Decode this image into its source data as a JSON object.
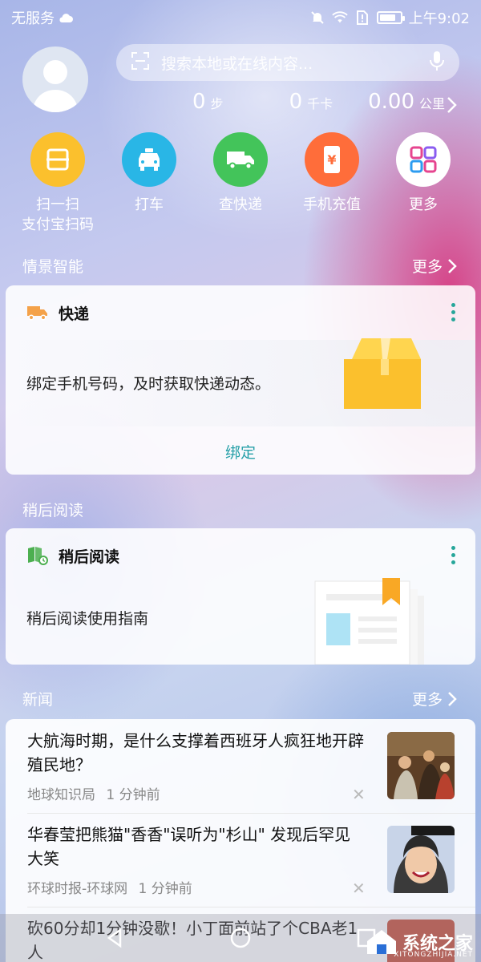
{
  "status_bar": {
    "carrier": "无服务",
    "time": "上午9:02"
  },
  "search": {
    "placeholder": "搜索本地或在线内容..."
  },
  "stats": [
    {
      "value": "0",
      "unit": "步"
    },
    {
      "value": "0",
      "unit": "千卡"
    },
    {
      "value": "0.00",
      "unit": "公里"
    }
  ],
  "quick_actions": [
    {
      "label": "扫一扫\n支付宝扫码",
      "color": "#fbc02d",
      "icon": "scan-icon"
    },
    {
      "label": "打车",
      "color": "#29b6e6",
      "icon": "taxi-icon"
    },
    {
      "label": "查快递",
      "color": "#43c45a",
      "icon": "delivery-truck-icon"
    },
    {
      "label": "手机充值",
      "color": "#ff6d3a",
      "icon": "phone-recharge-icon"
    },
    {
      "label": "更多",
      "color": "#ffffff",
      "icon": "more-grid-icon"
    }
  ],
  "sections": {
    "smart": {
      "title": "情景智能",
      "more": "更多"
    },
    "read_later": {
      "title": "稍后阅读"
    },
    "news": {
      "title": "新闻",
      "more": "更多"
    }
  },
  "express_card": {
    "title": "快递",
    "text": "绑定手机号码，及时获取快递动态。",
    "action": "绑定"
  },
  "read_card": {
    "title": "稍后阅读",
    "text": "稍后阅读使用指南"
  },
  "news_items": [
    {
      "title": "大航海时期，是什么支撑着西班牙人疯狂地开辟殖民地？",
      "source": "地球知识局",
      "time": "1 分钟前"
    },
    {
      "title": "华春莹把熊猫\"香香\"误听为\"杉山\" 发现后罕见大笑",
      "source": "环球时报-环球网",
      "time": "1 分钟前"
    },
    {
      "title": "砍60分却1分钟没歇！小丁面前站了个CBA老1人",
      "source": "",
      "time": ""
    }
  ],
  "watermark": {
    "text": "系统之家",
    "sub": "XITONGZHIJIA.NET"
  }
}
